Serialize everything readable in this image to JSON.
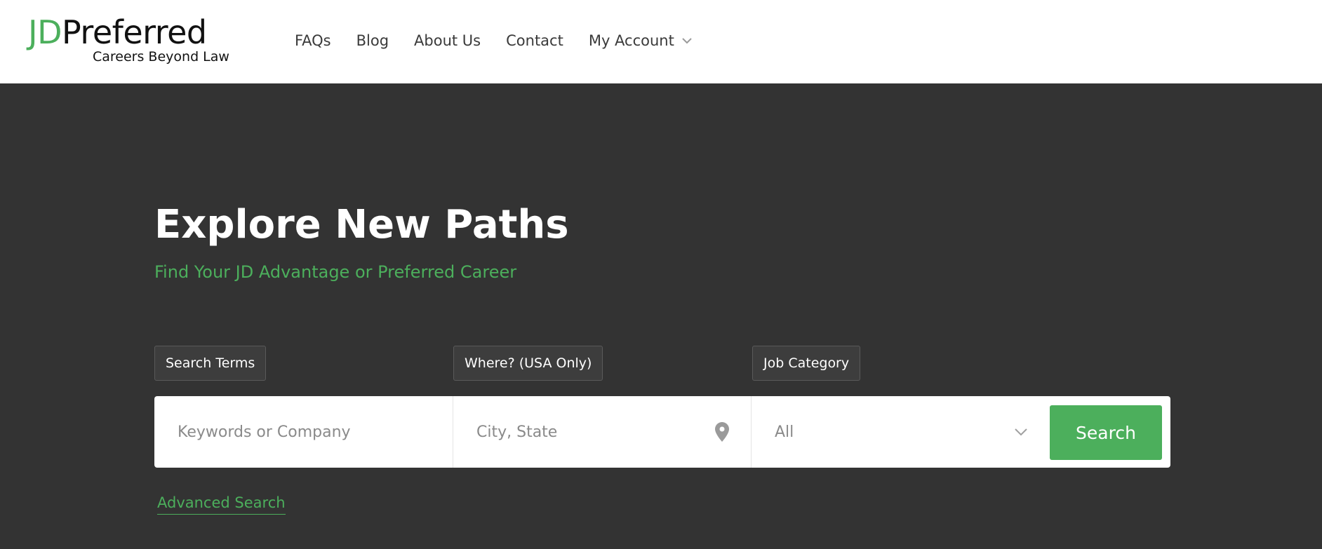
{
  "header": {
    "logo": {
      "jd": "JD",
      "preferred": "Preferred",
      "tagline": "Careers Beyond Law"
    },
    "nav": [
      {
        "label": "FAQs"
      },
      {
        "label": "Blog"
      },
      {
        "label": "About Us"
      },
      {
        "label": "Contact"
      },
      {
        "label": "My Account",
        "icon": "chevron-down-icon"
      }
    ]
  },
  "hero": {
    "title": "Explore New Paths",
    "subtitle": "Find Your JD Advantage or Preferred Career"
  },
  "search": {
    "labels": {
      "terms": "Search Terms",
      "where": "Where? (USA Only)",
      "category": "Job Category"
    },
    "keywords_placeholder": "Keywords or Company",
    "location_placeholder": "City, State",
    "category_value": "All",
    "button_label": "Search",
    "advanced_label": "Advanced Search"
  },
  "colors": {
    "accent_green": "#4caf5c",
    "hero_background": "#333333",
    "header_background": "#ffffff"
  }
}
